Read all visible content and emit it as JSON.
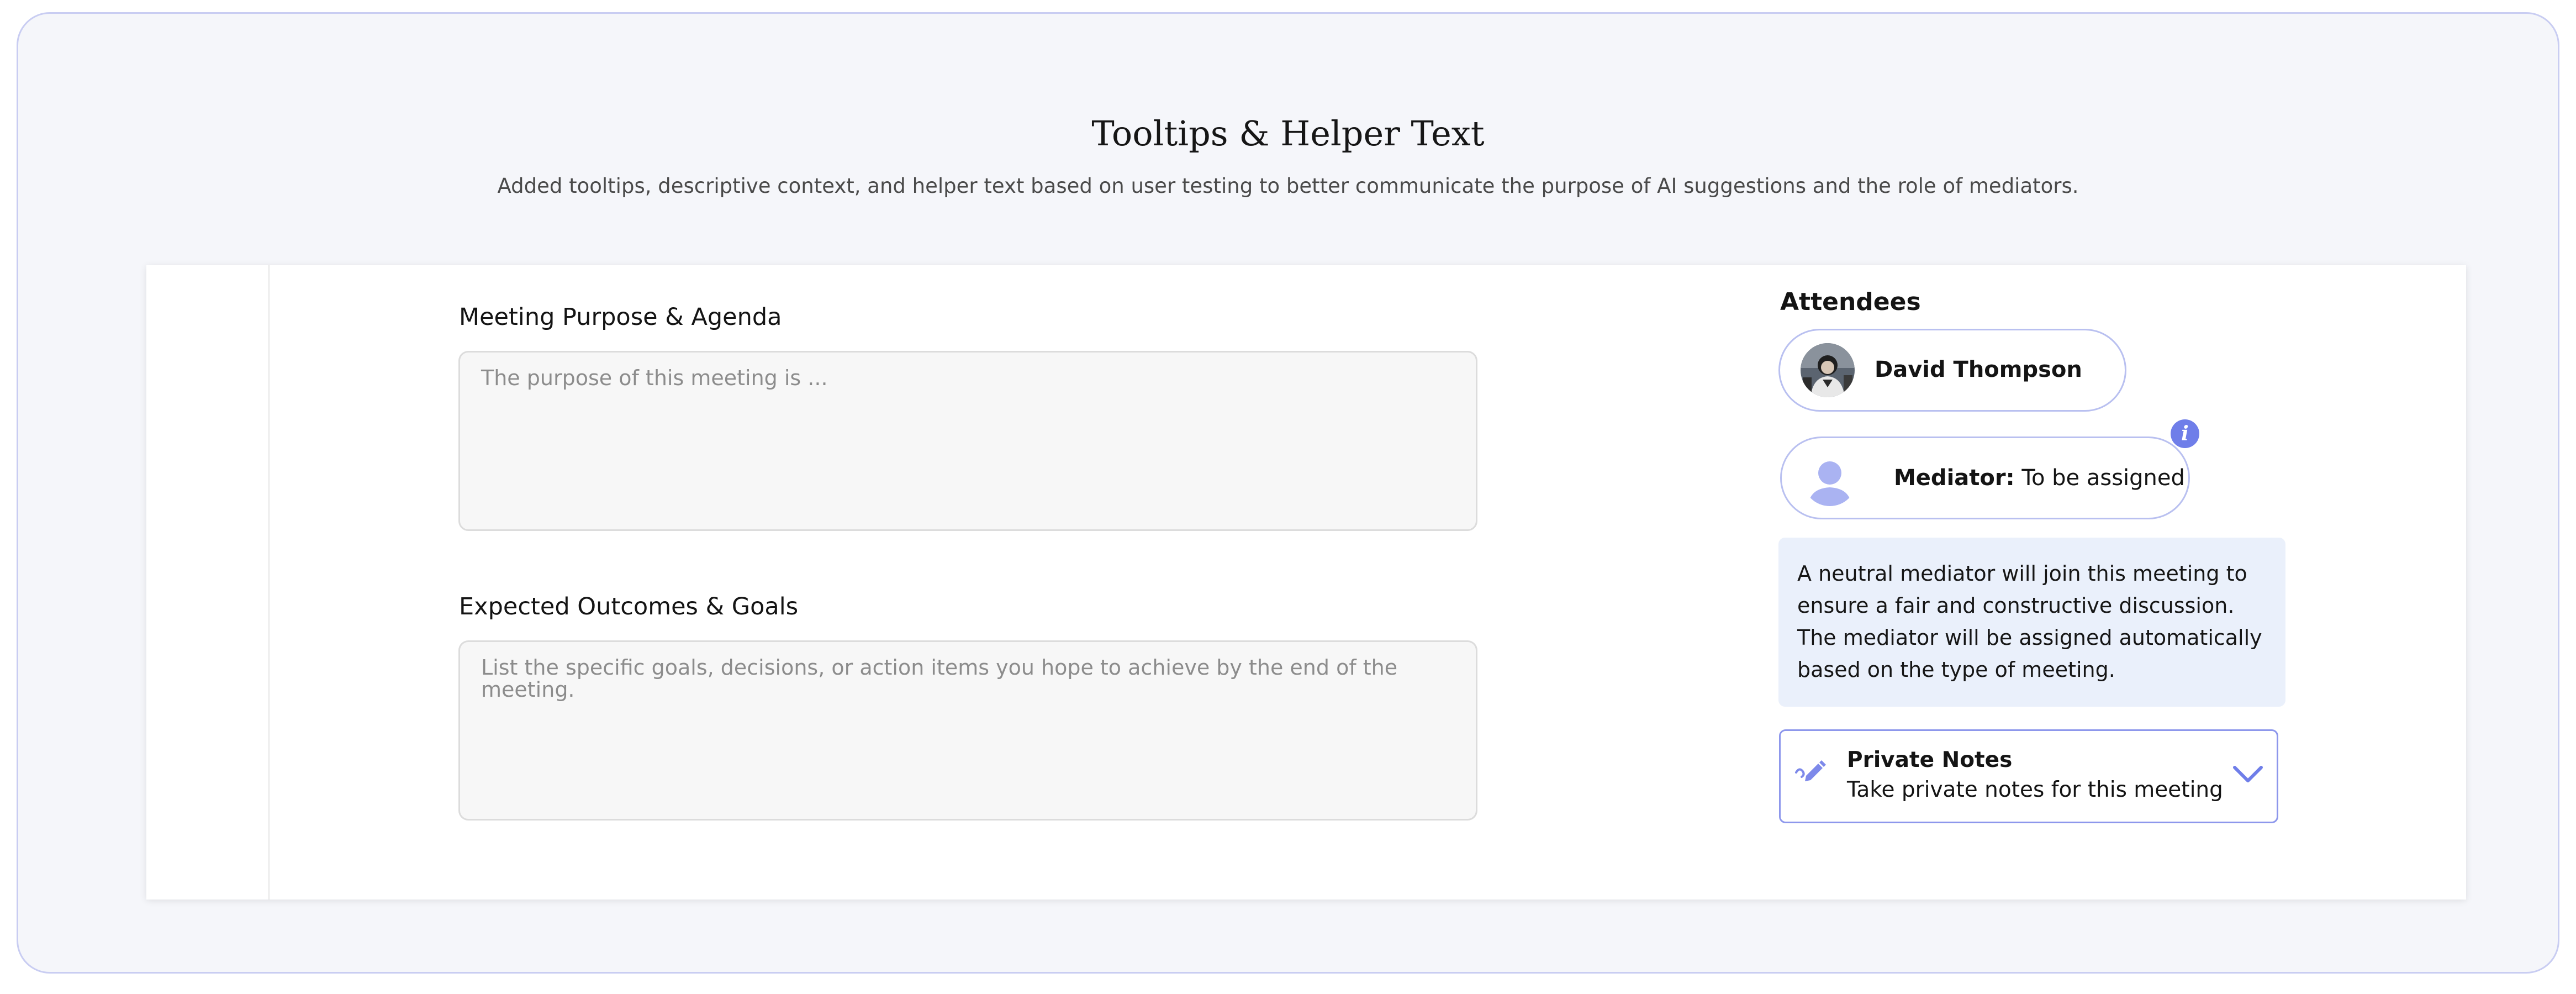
{
  "header": {
    "title": "Tooltips & Helper Text",
    "subtitle": "Added tooltips, descriptive context, and helper text based on user testing to better communicate the purpose of AI suggestions and the role of mediators."
  },
  "form": {
    "purpose": {
      "label": "Meeting Purpose & Agenda",
      "placeholder": "The purpose of this meeting is ...",
      "value": ""
    },
    "outcomes": {
      "label": "Expected Outcomes & Goals",
      "placeholder": "List the specific goals, decisions, or action items you hope to achieve by the end of the meeting.",
      "value": ""
    }
  },
  "attendees": {
    "title": "Attendees",
    "person": {
      "name": "David Thompson"
    },
    "mediator": {
      "role_label": "Mediator:",
      "status": "To be assigned",
      "info_icon_glyph": "i"
    },
    "tooltip": "A neutral mediator will join this meeting to ensure a fair and constructive discussion. The mediator will be assigned automatically based on the type of meeting."
  },
  "private_notes": {
    "title": "Private Notes",
    "description": "Take private notes for this meeting",
    "icon": "pencil-icon",
    "toggle_icon": "chevron-down-icon"
  },
  "colors": {
    "accent": "#6f7ee9",
    "card_border": "#c9cdf2",
    "tooltip_bg": "#eaf0fb"
  }
}
